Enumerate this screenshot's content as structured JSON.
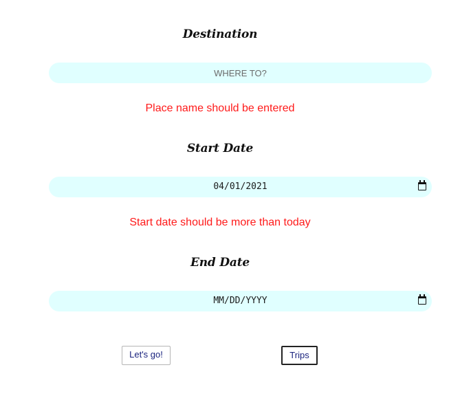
{
  "form": {
    "destination": {
      "label": "Destination",
      "placeholder": "WHERE TO?",
      "value": "",
      "error": "Place name should be entered"
    },
    "start_date": {
      "label": "Start Date",
      "value": "04/01/2021",
      "error": "Start date should be more than today"
    },
    "end_date": {
      "label": "End Date",
      "placeholder": "MM/DD/YYYY"
    }
  },
  "buttons": {
    "go_label": "Let's go!",
    "trips_label": "Trips"
  },
  "colors": {
    "field_bg": "#e0ffff",
    "error": "#ff1a1a",
    "button_text": "#1a237e"
  },
  "icons": {
    "date_picker": "calendar-icon"
  }
}
